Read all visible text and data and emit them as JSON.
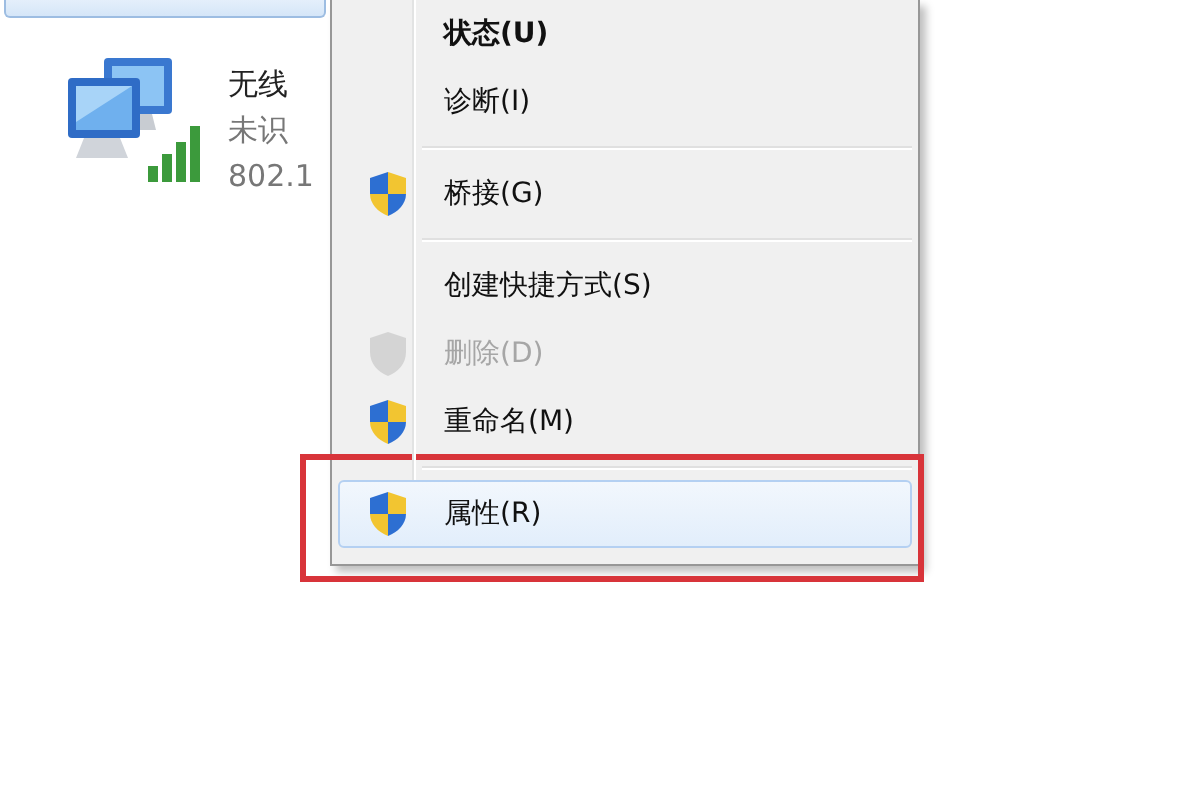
{
  "network_list": {
    "items": [
      {
        "selected": true
      },
      {
        "name": "无线",
        "status": "未识",
        "type": "802.1",
        "selected": false
      }
    ]
  },
  "context_menu": {
    "items": [
      {
        "kind": "item",
        "label": "状态(U)",
        "default": true,
        "disabled": false,
        "shield": false,
        "selected": false,
        "marked": false
      },
      {
        "kind": "item",
        "label": "诊断(I)",
        "default": false,
        "disabled": false,
        "shield": false,
        "selected": false,
        "marked": false
      },
      {
        "kind": "separator"
      },
      {
        "kind": "item",
        "label": "桥接(G)",
        "default": false,
        "disabled": false,
        "shield": true,
        "selected": false,
        "marked": false
      },
      {
        "kind": "separator"
      },
      {
        "kind": "item",
        "label": "创建快捷方式(S)",
        "default": false,
        "disabled": false,
        "shield": false,
        "selected": false,
        "marked": false
      },
      {
        "kind": "item",
        "label": "删除(D)",
        "default": false,
        "disabled": true,
        "shield": true,
        "selected": false,
        "marked": false
      },
      {
        "kind": "item",
        "label": "重命名(M)",
        "default": false,
        "disabled": false,
        "shield": true,
        "selected": false,
        "marked": false
      },
      {
        "kind": "separator"
      },
      {
        "kind": "item",
        "label": "属性(R)",
        "default": false,
        "disabled": false,
        "shield": true,
        "selected": true,
        "marked": true
      }
    ]
  }
}
